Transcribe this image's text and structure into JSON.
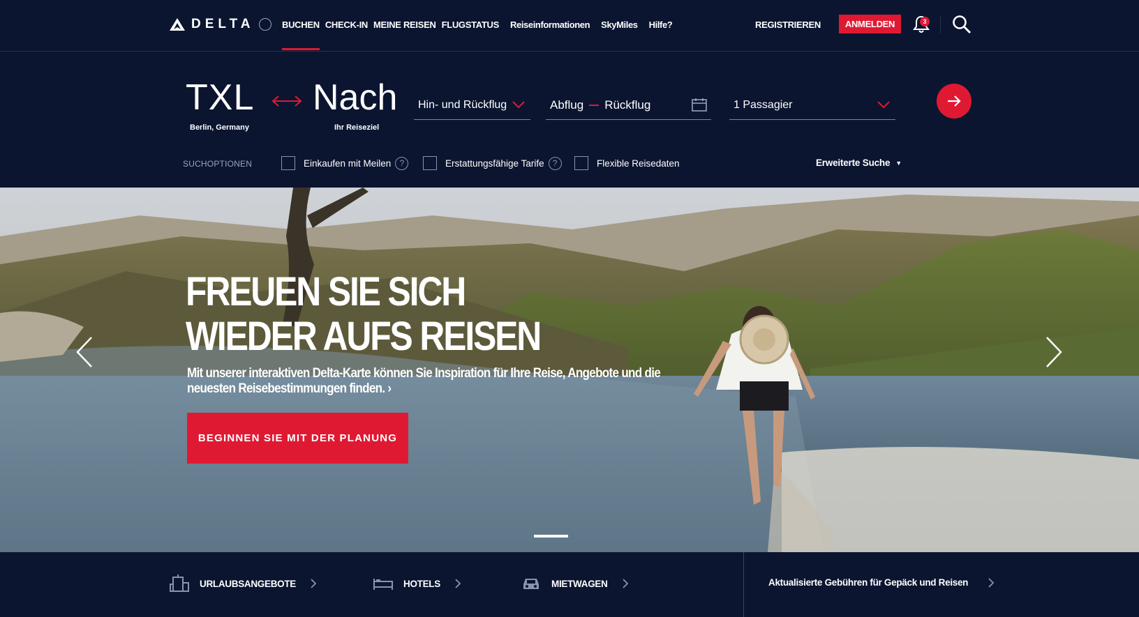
{
  "header": {
    "logo_text": "DELTA",
    "nav": {
      "book": "BUCHEN",
      "checkin": "CHECK-IN",
      "my_trips": "MEINE REISEN",
      "flight_status": "FLUGSTATUS",
      "travel_info": "Reiseinformationen",
      "skymiles": "SkyMiles",
      "help": "Hilfe?"
    },
    "register_label": "REGISTRIEREN",
    "login_label": "ANMELDEN",
    "notification_count": "3"
  },
  "booking": {
    "from_code": "TXL",
    "from_city": "Berlin, Germany",
    "to_code": "Nach",
    "to_hint": "Ihr Reiseziel",
    "trip_type": "Hin- und Rückflug",
    "depart_label": "Abflug",
    "return_label": "Rückflug",
    "passengers": "1 Passagier",
    "options_label": "SUCHOPTIONEN",
    "opt_miles": "Einkaufen mit Meilen",
    "opt_refundable": "Erstattungsfähige Tarife",
    "opt_flexible": "Flexible Reisedaten",
    "advanced_search": "Erweiterte Suche",
    "accent_color": "#e01933"
  },
  "hero": {
    "headline_line1": "FREUEN SIE SICH",
    "headline_line2": "WIEDER AUFS REISEN",
    "subtext": "Mit unserer interaktiven Delta-Karte können Sie Inspiration für Ihre Reise, Angebote und die neuesten Reisebestimmungen finden. ›",
    "cta_label": "BEGINNEN SIE MIT DER PLANUNG"
  },
  "bottom": {
    "vacation": "URLAUBSANGEBOTE",
    "hotels": "HOTELS",
    "cars": "MIETWAGEN",
    "fees_notice": "Aktualisierte Gebühren für Gepäck und Reisen"
  },
  "icons": {
    "nav": [
      "delta-logo-icon",
      "bell-icon",
      "search-icon"
    ],
    "booking": [
      "swap-arrows-icon",
      "chevron-down-icon",
      "calendar-icon",
      "arrow-right-icon",
      "help-icon"
    ],
    "hero": [
      "arrow-left-icon",
      "arrow-right-icon"
    ],
    "bottom": [
      "building-icon",
      "bed-icon",
      "car-icon",
      "chevron-right-icon"
    ]
  }
}
